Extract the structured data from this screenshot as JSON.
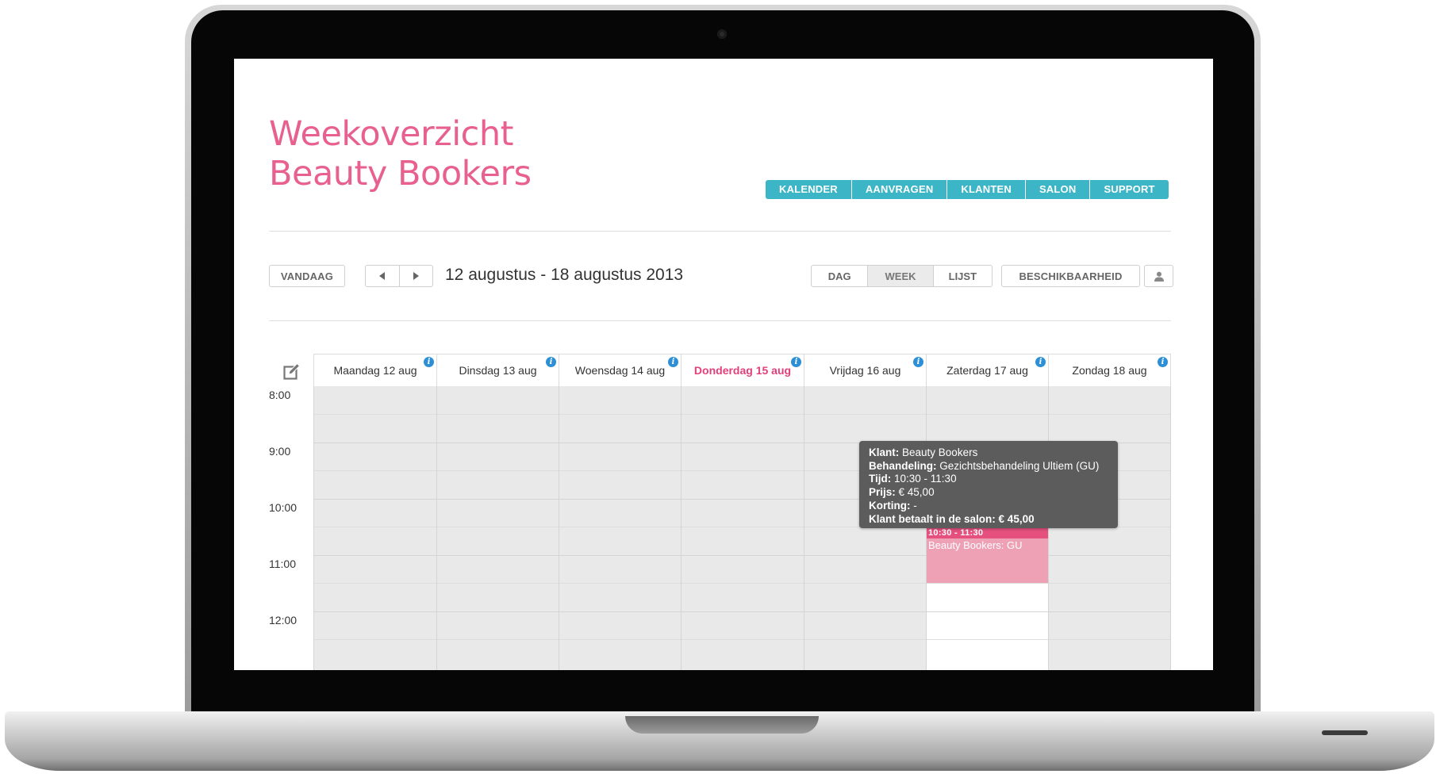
{
  "header": {
    "title_line1": "Weekoverzicht",
    "title_line2": "Beauty Bookers"
  },
  "main_nav": [
    "KALENDER",
    "AANVRAGEN",
    "KLANTEN",
    "SALON",
    "SUPPORT"
  ],
  "toolbar": {
    "today_label": "VANDAAG",
    "prev_icon": "triangle-left-icon",
    "next_icon": "triangle-right-icon",
    "date_range": "12 augustus - 18 augustus 2013",
    "views": [
      "DAG",
      "WEEK",
      "LIJST"
    ],
    "active_view": "WEEK",
    "availability_label": "BESCHIKBAARHEID",
    "user_icon": "user-icon"
  },
  "calendar": {
    "days": [
      {
        "label": "Maandag 12 aug",
        "today": false
      },
      {
        "label": "Dinsdag 13 aug",
        "today": false
      },
      {
        "label": "Woensdag 14 aug",
        "today": false
      },
      {
        "label": "Donderdag 15 aug",
        "today": true
      },
      {
        "label": "Vrijdag 16 aug",
        "today": false
      },
      {
        "label": "Zaterdag 17 aug",
        "today": false
      },
      {
        "label": "Zondag 18 aug",
        "today": false
      }
    ],
    "times": [
      "8:00",
      "9:00",
      "10:00",
      "11:00",
      "12:00"
    ],
    "event": {
      "time": "10:30 - 11:30",
      "title": "Beauty Bookers: GU",
      "day": "Zaterdag 17 aug"
    },
    "tooltip": {
      "client_label": "Klant:",
      "client_value": "Beauty Bookers",
      "treatment_label": "Behandeling:",
      "treatment_value": "Gezichtsbehandeling Ultiem (GU)",
      "time_label": "Tijd:",
      "time_value": "10:30 - 11:30",
      "price_label": "Prijs:",
      "price_value": "€ 45,00",
      "discount_label": "Korting:",
      "discount_value": "-",
      "pays_label": "Klant betaalt in de salon:",
      "pays_value": "€ 45,00"
    }
  },
  "colors": {
    "accent_pink": "#e8608f",
    "nav_teal": "#3cb6c6",
    "event_pink": "#eea1b5",
    "event_header": "#e5507f",
    "info_blue": "#2d8fd5"
  }
}
